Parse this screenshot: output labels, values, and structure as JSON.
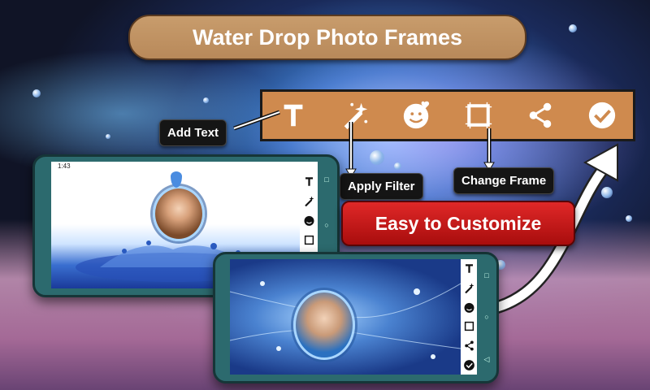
{
  "header": {
    "title": "Water Drop Photo Frames"
  },
  "toolbar": {
    "icons": [
      "text-icon",
      "magic-wand-icon",
      "sticker-icon",
      "frame-icon",
      "share-icon",
      "check-icon"
    ]
  },
  "callouts": {
    "add_text": "Add Text",
    "apply_filter": "Apply Filter",
    "change_frame": "Change Frame"
  },
  "banner": {
    "label": "Easy to Customize"
  },
  "phone1": {
    "status_time": "1:43"
  },
  "colors": {
    "toolbar": "#cf8a4e",
    "title_pill": "#c0925f",
    "banner_red": "#c91a1a",
    "phone_body": "#2c6a6e"
  }
}
